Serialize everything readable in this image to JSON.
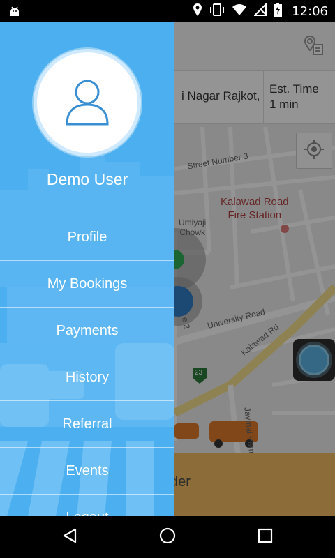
{
  "status_bar": {
    "time": "12:06",
    "icons": [
      "android-debug-icon",
      "location-icon",
      "vibrate-icon",
      "wifi-icon",
      "no-signal-icon",
      "battery-charging-icon"
    ]
  },
  "map": {
    "address_text": "i Nagar Rajkot, ",
    "est_time_label": "Est. Time",
    "est_time_value": "1 min",
    "labels": {
      "street_number_3": "Street Number 3",
      "fire_station_line1": "Kalawad Road",
      "fire_station_line2": "Fire Station",
      "umiyaji_line1": "Umiyaji",
      "umiyaji_line2": "Chowk",
      "university_road": "University Road",
      "kalawad_rd": "Kalawad Rd",
      "route_number": "23",
      "jaymal": "Jaymal Parmar",
      "side_road": "e 2"
    },
    "bottom_text": "der"
  },
  "drawer": {
    "user_name": "Demo User",
    "menu": [
      {
        "label": "Profile"
      },
      {
        "label": "My Bookings"
      },
      {
        "label": "Payments"
      },
      {
        "label": "History"
      },
      {
        "label": "Referral"
      },
      {
        "label": "Events"
      },
      {
        "label": "Logout"
      }
    ]
  },
  "colors": {
    "drawer_blue": "#4fb1ee",
    "bottom_bar": "#f1bc62",
    "poi_red": "#b04040"
  }
}
